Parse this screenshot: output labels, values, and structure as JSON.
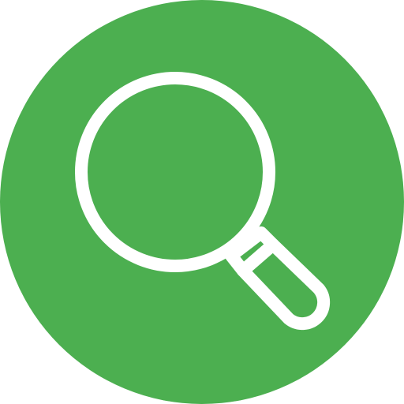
{
  "icon": {
    "name": "magnifying-glass-icon",
    "circle_color": "#4caf50",
    "glyph_color": "#ffffff"
  }
}
